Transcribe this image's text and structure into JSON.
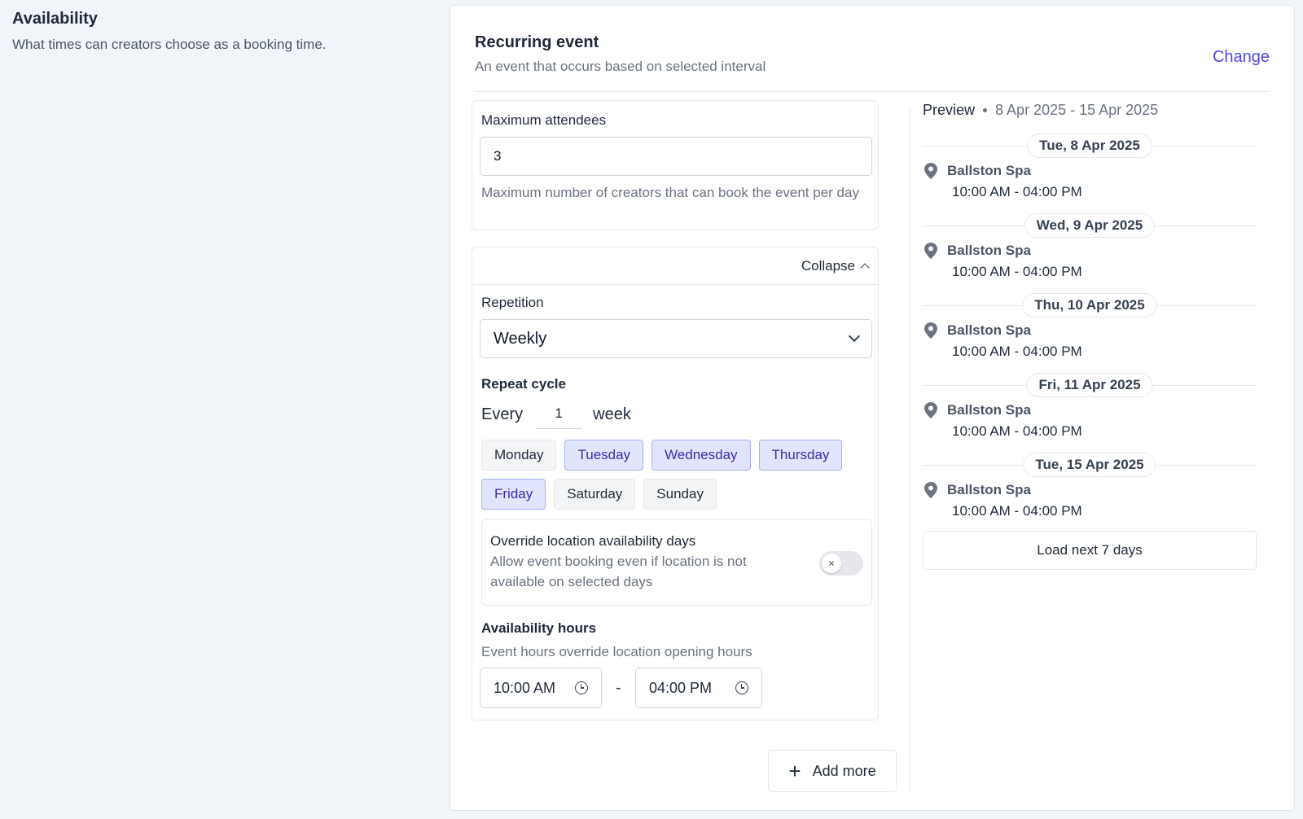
{
  "section": {
    "title": "Availability",
    "subtitle": "What times can creators choose as a booking time."
  },
  "card": {
    "title": "Recurring event",
    "description": "An event that occurs based on selected interval",
    "change_label": "Change"
  },
  "attendees": {
    "label": "Maximum attendees",
    "value": "3",
    "help": "Maximum number of creators that can book the event per day"
  },
  "schedule": {
    "collapse_label": "Collapse",
    "repetition_label": "Repetition",
    "repetition_value": "Weekly",
    "repeat_cycle_label": "Repeat cycle",
    "every_label": "Every",
    "every_value": "1",
    "unit_label": "week",
    "days": [
      {
        "label": "Monday",
        "selected": false
      },
      {
        "label": "Tuesday",
        "selected": true
      },
      {
        "label": "Wednesday",
        "selected": true
      },
      {
        "label": "Thursday",
        "selected": true
      },
      {
        "label": "Friday",
        "selected": true
      },
      {
        "label": "Saturday",
        "selected": false
      },
      {
        "label": "Sunday",
        "selected": false
      }
    ],
    "override": {
      "title": "Override location availability days",
      "description": "Allow event booking even if location is not available on selected days",
      "enabled": false,
      "toggle_glyph": "×"
    },
    "hours": {
      "label": "Availability hours",
      "help": "Event hours override location opening hours",
      "start": "10:00 AM",
      "separator": "-",
      "end": "04:00 PM"
    }
  },
  "add_more_label": "Add more",
  "add_more_icon": "+",
  "preview": {
    "label": "Preview",
    "range": "8 Apr 2025 - 15 Apr 2025",
    "entries": [
      {
        "date": "Tue, 8 Apr 2025",
        "location": "Ballston Spa",
        "time": "10:00 AM - 04:00 PM"
      },
      {
        "date": "Wed, 9 Apr 2025",
        "location": "Ballston Spa",
        "time": "10:00 AM - 04:00 PM"
      },
      {
        "date": "Thu, 10 Apr 2025",
        "location": "Ballston Spa",
        "time": "10:00 AM - 04:00 PM"
      },
      {
        "date": "Fri, 11 Apr 2025",
        "location": "Ballston Spa",
        "time": "10:00 AM - 04:00 PM"
      },
      {
        "date": "Tue, 15 Apr 2025",
        "location": "Ballston Spa",
        "time": "10:00 AM - 04:00 PM"
      }
    ],
    "load_label": "Load next 7 days"
  },
  "colors": {
    "accent": "#4f46e5",
    "selected_day_bg": "#e0e4fc",
    "page_bg": "#f1f4f9"
  }
}
